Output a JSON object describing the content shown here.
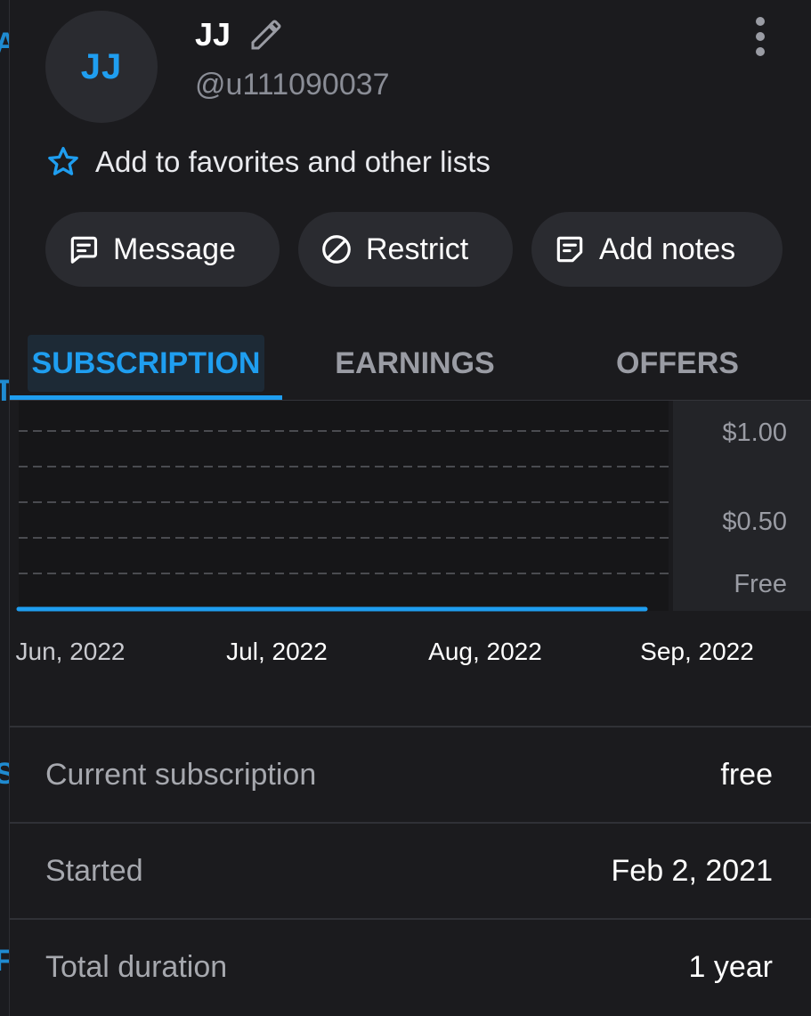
{
  "profile": {
    "initials": "JJ",
    "name": "JJ",
    "handle": "@u111090037"
  },
  "favorites": {
    "label": "Add to favorites and other lists"
  },
  "actions": {
    "message": "Message",
    "restrict": "Restrict",
    "add_notes": "Add notes"
  },
  "tabs": [
    {
      "label": "SUBSCRIPTION",
      "active": true
    },
    {
      "label": "EARNINGS",
      "active": false
    },
    {
      "label": "OFFERS",
      "active": false
    }
  ],
  "chart_data": {
    "type": "line",
    "title": "",
    "xlabel": "",
    "ylabel": "",
    "x_ticks": [
      "Jun, 2022",
      "Jul, 2022",
      "Aug, 2022",
      "Sep, 2022"
    ],
    "y_ticks": [
      "$1.00",
      "$0.50",
      "Free"
    ],
    "ylim": [
      0,
      1
    ],
    "grid": true,
    "series": [
      {
        "color": "#1f9ef0",
        "x": [
          "Jun, 2022",
          "Sep, 2022"
        ],
        "values": [
          0,
          0
        ]
      }
    ]
  },
  "details": [
    {
      "label": "Current subscription",
      "value": "free"
    },
    {
      "label": "Started",
      "value": "Feb 2, 2021"
    },
    {
      "label": "Total duration",
      "value": "1 year"
    }
  ],
  "colors": {
    "accent": "#1f9ef0",
    "background": "#1b1b1e",
    "pill": "#2a2b30"
  }
}
